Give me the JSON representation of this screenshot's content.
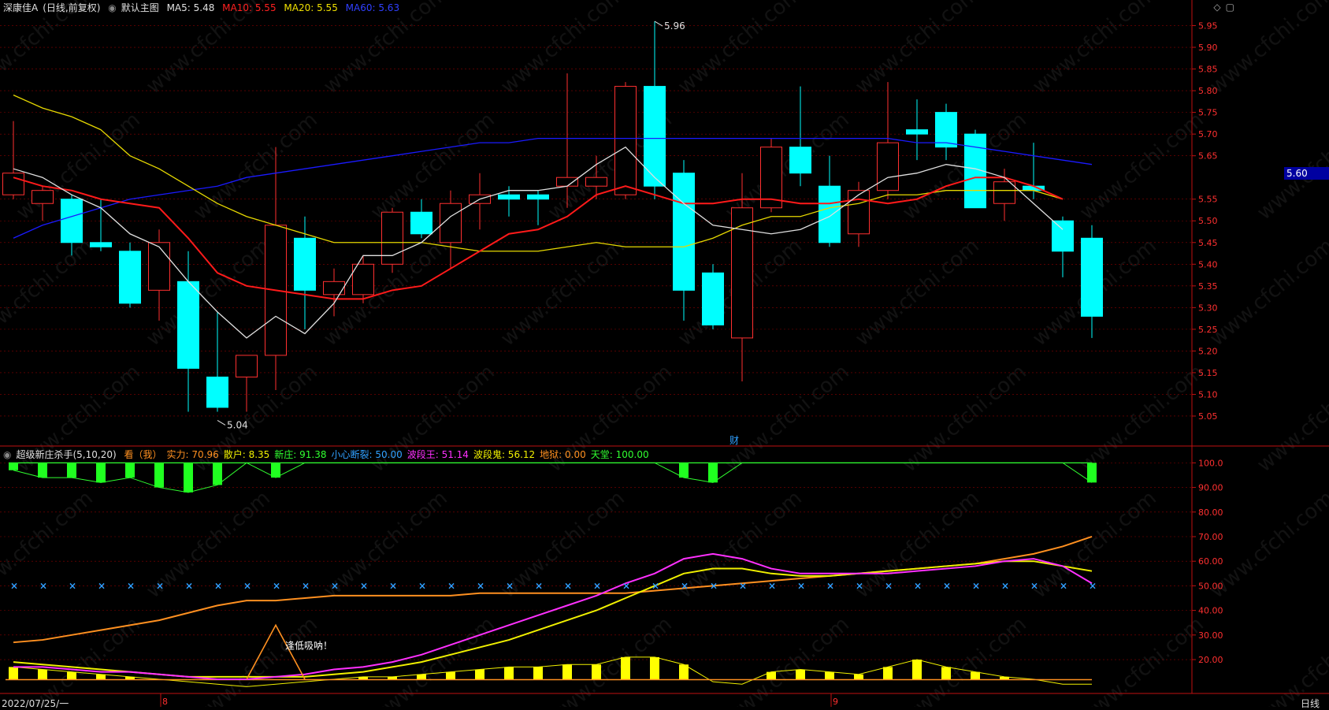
{
  "header": {
    "stock_name": "深康佳A",
    "period": "(日线,前复权)",
    "main_chart_label": "默认主图",
    "ma": [
      {
        "label": "MA5: 5.48",
        "color": "#e0e0e0"
      },
      {
        "label": "MA10: 5.55",
        "color": "#ff2020"
      },
      {
        "label": "MA20: 5.55",
        "color": "#f0e000"
      },
      {
        "label": "MA60: 5.63",
        "color": "#1020ff"
      }
    ]
  },
  "indicator_header": {
    "name": "超级新庄杀手(5,10,20)",
    "items": [
      {
        "label": "看（我）",
        "color": "#ff9020"
      },
      {
        "label": "实力: 70.96",
        "color": "#ff9020"
      },
      {
        "label": "散户: 8.35",
        "color": "#f0f000"
      },
      {
        "label": "新庄: 91.38",
        "color": "#30ff30"
      },
      {
        "label": "小心断裂: 50.00",
        "color": "#30a0ff"
      },
      {
        "label": "波段王: 51.14",
        "color": "#ff30ff"
      },
      {
        "label": "波段鬼: 56.12",
        "color": "#f0f000"
      },
      {
        "label": "地狱: 0.00",
        "color": "#ff9020"
      },
      {
        "label": "天堂: 100.00",
        "color": "#30ff30"
      }
    ]
  },
  "top_icons": [
    "diamond-icon",
    "window-icon"
  ],
  "current_price": "5.60",
  "price_axis": [
    "5.95",
    "5.90",
    "5.85",
    "5.80",
    "5.75",
    "5.70",
    "5.65",
    "5.55",
    "5.50",
    "5.45",
    "5.40",
    "5.35",
    "5.30",
    "5.25",
    "5.20",
    "5.15",
    "5.10",
    "5.05"
  ],
  "ind_axis": [
    "100.0",
    "90.00",
    "80.00",
    "70.00",
    "60.00",
    "50.00",
    "40.00",
    "30.00",
    "20.00"
  ],
  "annotations": {
    "high": "5.96",
    "low": "5.04",
    "finance_marker": "财",
    "signal_text": "逢低吸呐！"
  },
  "date_label": "2022/07/25/一",
  "month_marks": [
    "8",
    "9"
  ],
  "period_label": "日线",
  "watermark": "www.cfchi.com",
  "chart_data": {
    "type": "candlestick",
    "ylim": [
      5.01,
      5.98
    ],
    "candles": [
      {
        "o": 5.56,
        "h": 5.73,
        "l": 5.55,
        "c": 5.61
      },
      {
        "o": 5.54,
        "h": 5.58,
        "l": 5.5,
        "c": 5.57
      },
      {
        "o": 5.55,
        "h": 5.56,
        "l": 5.42,
        "c": 5.45
      },
      {
        "o": 5.45,
        "h": 5.55,
        "l": 5.43,
        "c": 5.44
      },
      {
        "o": 5.43,
        "h": 5.45,
        "l": 5.3,
        "c": 5.31
      },
      {
        "o": 5.34,
        "h": 5.48,
        "l": 5.27,
        "c": 5.45
      },
      {
        "o": 5.36,
        "h": 5.43,
        "l": 5.06,
        "c": 5.16
      },
      {
        "o": 5.14,
        "h": 5.29,
        "l": 5.06,
        "c": 5.07
      },
      {
        "o": 5.14,
        "h": 5.19,
        "l": 5.06,
        "c": 5.19
      },
      {
        "o": 5.19,
        "h": 5.67,
        "l": 5.11,
        "c": 5.49
      },
      {
        "o": 5.46,
        "h": 5.51,
        "l": 5.25,
        "c": 5.34
      },
      {
        "o": 5.33,
        "h": 5.39,
        "l": 5.28,
        "c": 5.36
      },
      {
        "o": 5.33,
        "h": 5.42,
        "l": 5.31,
        "c": 5.4
      },
      {
        "o": 5.4,
        "h": 5.53,
        "l": 5.38,
        "c": 5.52
      },
      {
        "o": 5.52,
        "h": 5.55,
        "l": 5.46,
        "c": 5.47
      },
      {
        "o": 5.45,
        "h": 5.57,
        "l": 5.39,
        "c": 5.54
      },
      {
        "o": 5.54,
        "h": 5.61,
        "l": 5.48,
        "c": 5.56
      },
      {
        "o": 5.56,
        "h": 5.58,
        "l": 5.51,
        "c": 5.55
      },
      {
        "o": 5.56,
        "h": 5.57,
        "l": 5.49,
        "c": 5.55
      },
      {
        "o": 5.58,
        "h": 5.84,
        "l": 5.53,
        "c": 5.6
      },
      {
        "o": 5.58,
        "h": 5.65,
        "l": 5.55,
        "c": 5.6
      },
      {
        "o": 5.56,
        "h": 5.82,
        "l": 5.55,
        "c": 5.81
      },
      {
        "o": 5.81,
        "h": 5.96,
        "l": 5.55,
        "c": 5.58
      },
      {
        "o": 5.61,
        "h": 5.64,
        "l": 5.27,
        "c": 5.34
      },
      {
        "o": 5.38,
        "h": 5.4,
        "l": 5.25,
        "c": 5.26
      },
      {
        "o": 5.23,
        "h": 5.61,
        "l": 5.13,
        "c": 5.53
      },
      {
        "o": 5.53,
        "h": 5.69,
        "l": 5.52,
        "c": 5.67
      },
      {
        "o": 5.67,
        "h": 5.81,
        "l": 5.58,
        "c": 5.61
      },
      {
        "o": 5.58,
        "h": 5.65,
        "l": 5.44,
        "c": 5.45
      },
      {
        "o": 5.47,
        "h": 5.59,
        "l": 5.44,
        "c": 5.57
      },
      {
        "o": 5.57,
        "h": 5.82,
        "l": 5.55,
        "c": 5.68
      },
      {
        "o": 5.71,
        "h": 5.78,
        "l": 5.64,
        "c": 5.7
      },
      {
        "o": 5.75,
        "h": 5.77,
        "l": 5.64,
        "c": 5.67
      },
      {
        "o": 5.7,
        "h": 5.71,
        "l": 5.53,
        "c": 5.53
      },
      {
        "o": 5.54,
        "h": 5.62,
        "l": 5.5,
        "c": 5.59
      },
      {
        "o": 5.58,
        "h": 5.68,
        "l": 5.55,
        "c": 5.57
      },
      {
        "o": 5.5,
        "h": 5.51,
        "l": 5.37,
        "c": 5.43
      },
      {
        "o": 5.46,
        "h": 5.49,
        "l": 5.23,
        "c": 5.28
      }
    ],
    "ma5": [
      5.62,
      5.6,
      5.56,
      5.53,
      5.47,
      5.44,
      5.36,
      5.29,
      5.23,
      5.28,
      5.24,
      5.31,
      5.42,
      5.42,
      5.45,
      5.51,
      5.55,
      5.57,
      5.57,
      5.58,
      5.63,
      5.67,
      5.6,
      5.54,
      5.49,
      5.48,
      5.47,
      5.48,
      5.51,
      5.56,
      5.6,
      5.61,
      5.63,
      5.62,
      5.6,
      5.54,
      5.48
    ],
    "ma10": [
      5.6,
      5.58,
      5.57,
      5.55,
      5.54,
      5.53,
      5.46,
      5.38,
      5.35,
      5.34,
      5.33,
      5.32,
      5.32,
      5.34,
      5.35,
      5.39,
      5.43,
      5.47,
      5.48,
      5.51,
      5.56,
      5.58,
      5.56,
      5.54,
      5.54,
      5.55,
      5.55,
      5.54,
      5.54,
      5.55,
      5.54,
      5.55,
      5.58,
      5.6,
      5.6,
      5.58,
      5.55
    ],
    "ma20": [
      5.79,
      5.76,
      5.74,
      5.71,
      5.65,
      5.62,
      5.58,
      5.54,
      5.51,
      5.49,
      5.47,
      5.45,
      5.45,
      5.45,
      5.45,
      5.44,
      5.43,
      5.43,
      5.43,
      5.44,
      5.45,
      5.44,
      5.44,
      5.44,
      5.46,
      5.49,
      5.51,
      5.51,
      5.53,
      5.54,
      5.56,
      5.56,
      5.57,
      5.57,
      5.57,
      5.57,
      5.55
    ],
    "ma60": [
      5.46,
      5.49,
      5.51,
      5.53,
      5.55,
      5.56,
      5.57,
      5.58,
      5.6,
      5.61,
      5.62,
      5.63,
      5.64,
      5.65,
      5.66,
      5.67,
      5.68,
      5.68,
      5.69,
      5.69,
      5.69,
      5.69,
      5.69,
      5.69,
      5.69,
      5.69,
      5.69,
      5.69,
      5.69,
      5.69,
      5.69,
      5.68,
      5.68,
      5.67,
      5.66,
      5.65,
      5.64,
      5.63
    ],
    "indicator": {
      "ylim": [
        12,
        103
      ],
      "heaven": 100,
      "green_bars": [
        97,
        94,
        94,
        92,
        94,
        90,
        88,
        91,
        100,
        94,
        100,
        100,
        100,
        100,
        100,
        100,
        100,
        100,
        100,
        100,
        100,
        100,
        100,
        94,
        92,
        100,
        100,
        100,
        100,
        100,
        100,
        100,
        100,
        100,
        100,
        100,
        100,
        92
      ],
      "orange": [
        27,
        28,
        30,
        32,
        34,
        36,
        39,
        42,
        44,
        44,
        45,
        46,
        46,
        46,
        46,
        46,
        47,
        47,
        47,
        47,
        47,
        47,
        48,
        49,
        50,
        51,
        52,
        53,
        54,
        55,
        56,
        57,
        58,
        59,
        61,
        63,
        66,
        70
      ],
      "magenta": [
        17,
        17,
        16,
        15,
        15,
        14,
        13,
        12,
        12,
        13,
        14,
        16,
        17,
        19,
        22,
        26,
        30,
        34,
        38,
        42,
        46,
        51,
        55,
        61,
        63,
        61,
        57,
        55,
        55,
        55,
        55,
        56,
        57,
        58,
        60,
        61,
        58,
        51
      ],
      "yellow": [
        19,
        18,
        17,
        16,
        15,
        14,
        13,
        13,
        13,
        13,
        13,
        14,
        15,
        17,
        19,
        22,
        25,
        28,
        32,
        36,
        40,
        45,
        50,
        55,
        57,
        57,
        55,
        54,
        54,
        55,
        56,
        57,
        58,
        59,
        60,
        60,
        58,
        56
      ],
      "yellow_bars": [
        17,
        16,
        15,
        14,
        13,
        12,
        11,
        10,
        9,
        10,
        11,
        12,
        13,
        13,
        14,
        15,
        16,
        17,
        17,
        18,
        18,
        21,
        21,
        18,
        11,
        10,
        15,
        16,
        15,
        14,
        17,
        20,
        17,
        15,
        13,
        12,
        10,
        10
      ],
      "x_marks_level": 50,
      "signal_peak_index": 9,
      "signal_peak_value": 34
    }
  },
  "colors": {
    "up": "#ff3030",
    "down": "#00ffff",
    "grid": "#8a0000",
    "axis": "#c01010",
    "ma5": "#e0e0e0",
    "ma10": "#ff1a1a",
    "ma20": "#e6d800",
    "ma60": "#1a1aff"
  }
}
